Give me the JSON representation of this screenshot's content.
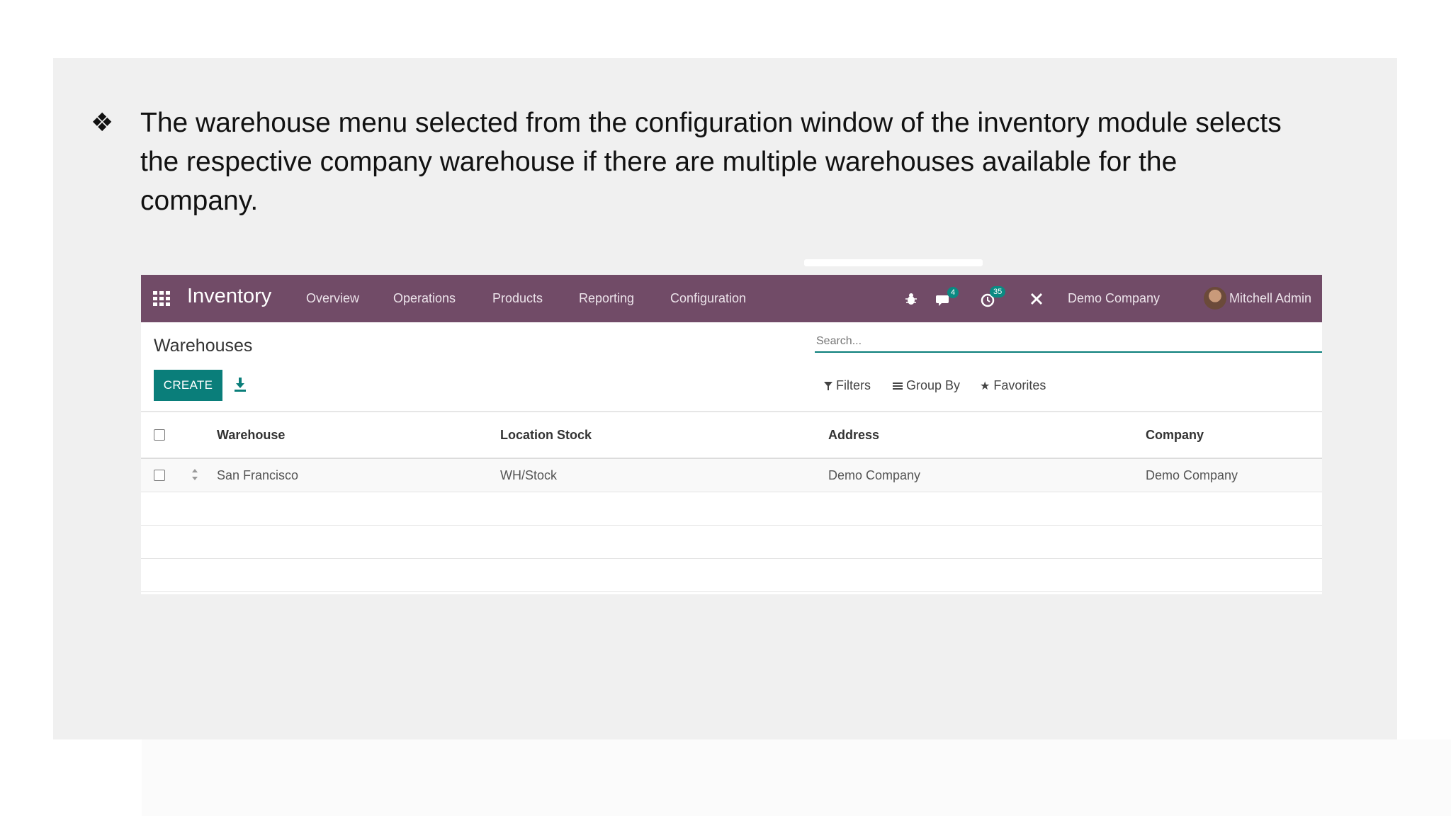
{
  "slide": {
    "bullet_glyph": "❖",
    "bullet_text": "The warehouse menu selected from the configuration window of the inventory module selects the respective company warehouse if there are multiple warehouses available for the company."
  },
  "navbar": {
    "app_name": "Inventory",
    "menu": [
      "Overview",
      "Operations",
      "Products",
      "Reporting",
      "Configuration"
    ],
    "messages_count": "4",
    "activities_count": "35",
    "company": "Demo Company",
    "user": "Mitchell Admin",
    "icons": [
      "apps-grid-icon",
      "bug-icon",
      "chat-icon",
      "clock-icon",
      "tools-icon"
    ],
    "color": "#714b67"
  },
  "control_panel": {
    "title": "Warehouses",
    "search_placeholder": "Search...",
    "create_label": "CREATE",
    "filters_label": "Filters",
    "group_by_label": "Group By",
    "favorites_label": "Favorites",
    "accent_color": "#0a7e7a"
  },
  "table": {
    "columns": [
      "Warehouse",
      "Location Stock",
      "Address",
      "Company"
    ],
    "rows": [
      {
        "warehouse": "San Francisco",
        "location_stock": "WH/Stock",
        "address": "Demo Company",
        "company": "Demo Company"
      }
    ]
  }
}
